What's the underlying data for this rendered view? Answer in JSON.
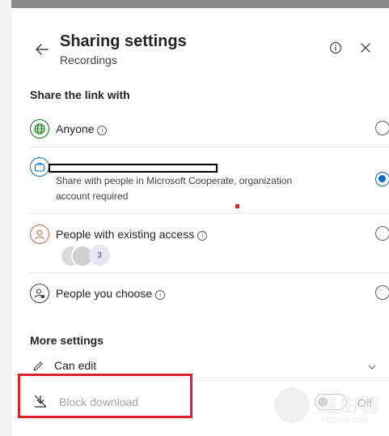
{
  "header": {
    "title": "Sharing settings",
    "subtitle": "Recordings"
  },
  "share": {
    "heading": "Share the link with",
    "options": [
      {
        "label": "Anyone",
        "selected": false,
        "icon": "globe-icon"
      },
      {
        "label": "",
        "description": "Share with people in Microsoft Cooperate, organization account required",
        "selected": true,
        "icon": "briefcase-icon",
        "label_redacted": true
      },
      {
        "label": "People with existing access",
        "selected": false,
        "icon": "person-icon",
        "avatar_count": "3"
      },
      {
        "label": "People you choose",
        "selected": false,
        "icon": "person-lock-icon"
      }
    ]
  },
  "more": {
    "heading": "More settings",
    "permission": "Can edit",
    "block_download": "Block download",
    "block_download_state": "Off"
  },
  "watermark": {
    "title": "路由器",
    "url": "luyouqi.com"
  },
  "colors": {
    "accent": "#0f6cbd",
    "highlight": "#e0202a",
    "globe": "#107c10",
    "briefcase": "#0f6cbd",
    "person": "#c4674f"
  }
}
